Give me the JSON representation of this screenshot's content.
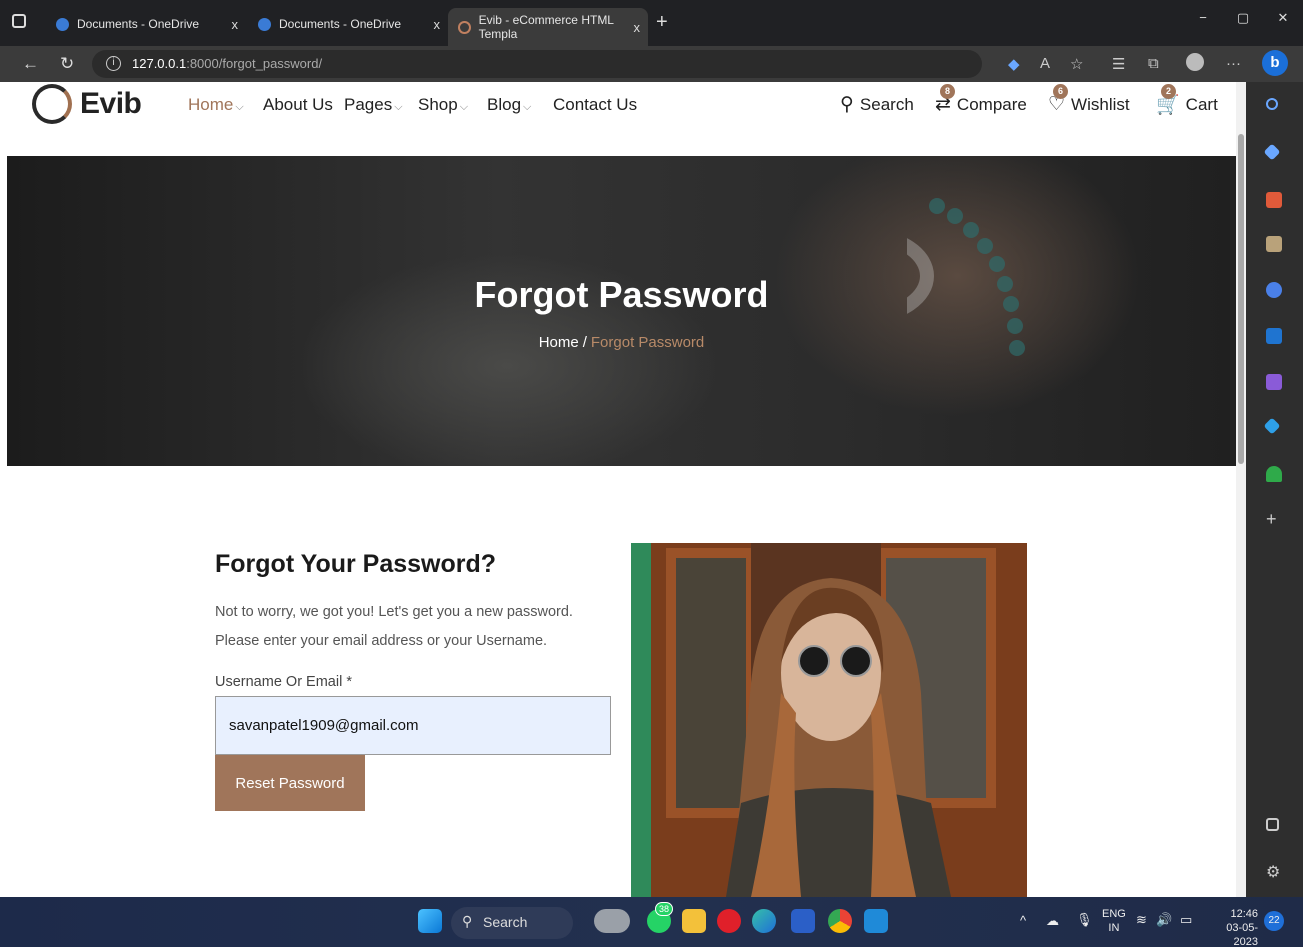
{
  "browser": {
    "tabs": [
      {
        "title": "Documents - OneDrive",
        "close": "x"
      },
      {
        "title": "Documents - OneDrive",
        "close": "x"
      },
      {
        "title": "Evib - eCommerce HTML Templa",
        "close": "x"
      }
    ],
    "new_tab": "+",
    "window_controls": {
      "minimize": "−",
      "restore": "▢",
      "close": "✕"
    },
    "url_host": "127.0.0.1",
    "url_path": ":8000/forgot_password/",
    "more": "···"
  },
  "site": {
    "brand": "Evib",
    "nav": [
      {
        "label": "Home",
        "dropdown": true,
        "active": true
      },
      {
        "label": "About Us",
        "dropdown": false
      },
      {
        "label": "Pages",
        "dropdown": true
      },
      {
        "label": "Shop",
        "dropdown": true
      },
      {
        "label": "Blog",
        "dropdown": true
      },
      {
        "label": "Contact Us",
        "dropdown": false
      }
    ],
    "actions": {
      "search": "Search",
      "compare": "Compare",
      "compare_count": "8",
      "wishlist": "Wishlist",
      "wishlist_count": "6",
      "cart": "Cart",
      "cart_count": "2"
    },
    "accent": "#a0755a"
  },
  "hero": {
    "title": "Forgot Password",
    "crumb_home": "Home",
    "crumb_sep": "/",
    "crumb_current": "Forgot Password"
  },
  "form": {
    "title": "Forgot Your Password?",
    "description": "Not to worry, we got you! Let's get you a new password. Please enter your email address or your Username.",
    "field_label": "Username Or Email *",
    "field_value": "savanpatel1909@gmail.com",
    "submit": "Reset Password"
  },
  "taskbar": {
    "search": "Search",
    "whatsapp_badge": "38",
    "lang": "ENG",
    "region": "IN",
    "time": "12:46",
    "date": "03-05-2023",
    "notifications": "22"
  }
}
